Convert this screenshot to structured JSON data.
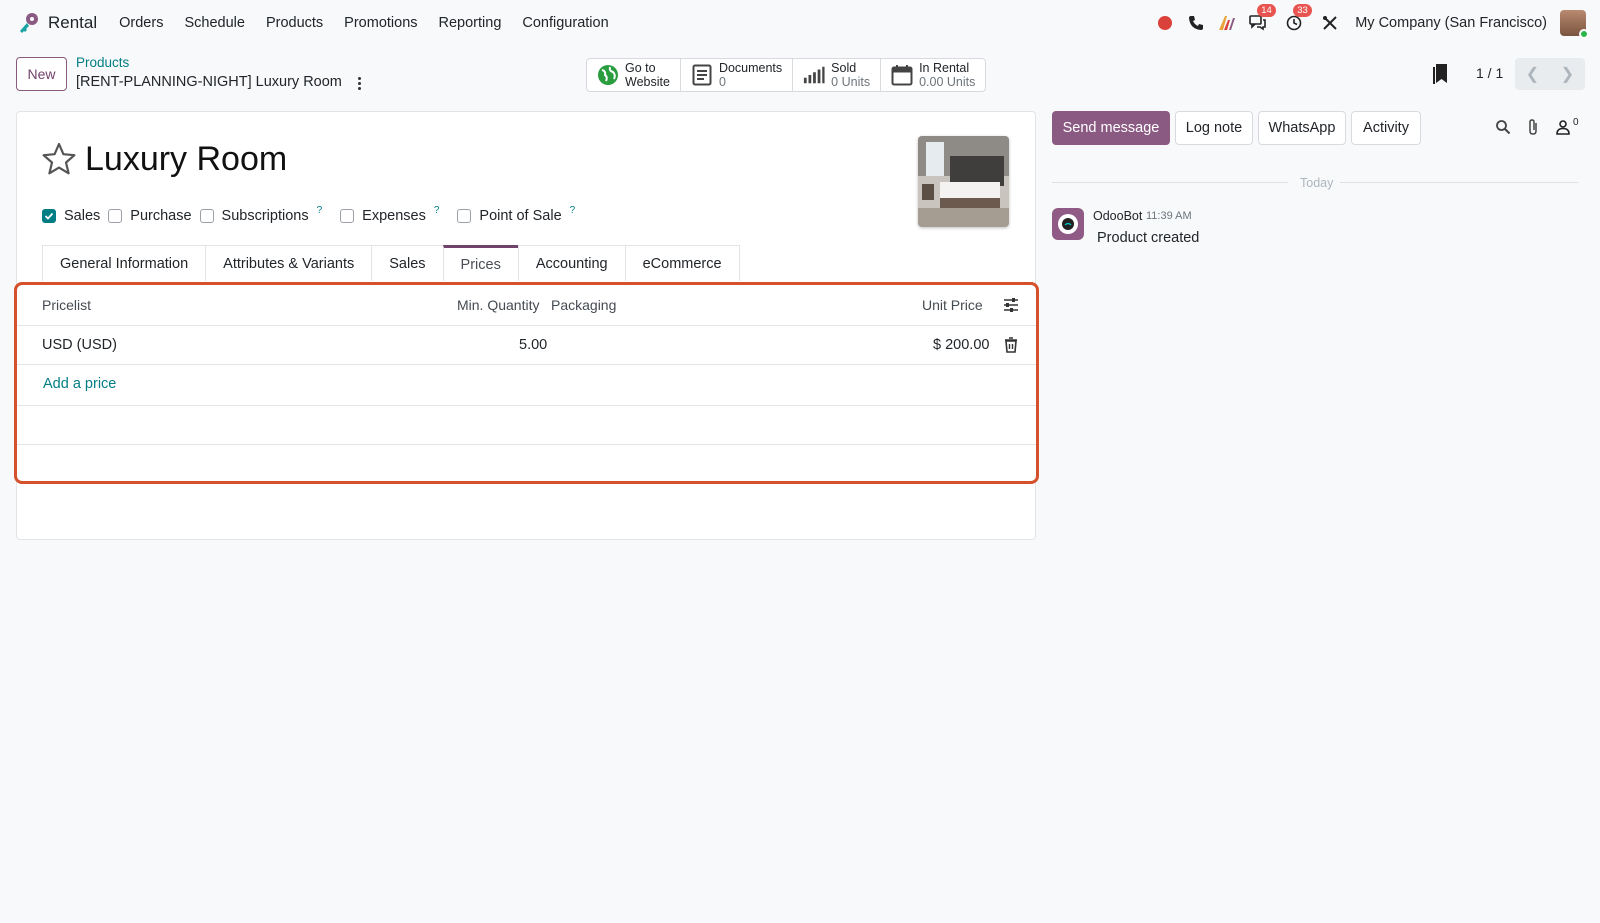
{
  "nav": {
    "app_name": "Rental",
    "menu": [
      "Orders",
      "Schedule",
      "Products",
      "Promotions",
      "Reporting",
      "Configuration"
    ],
    "messages_badge": "14",
    "activities_badge": "33",
    "company": "My Company (San Francisco)"
  },
  "control": {
    "new_label": "New",
    "breadcrumb_parent": "Products",
    "breadcrumb_current": "[RENT-PLANNING-NIGHT] Luxury Room",
    "stats": [
      {
        "title": "Go to",
        "value": "Website",
        "icon": "globe-icon"
      },
      {
        "title": "Documents",
        "value": "0",
        "icon": "document-icon"
      },
      {
        "title": "Sold",
        "value": "0 Units",
        "icon": "signal-bars-icon"
      },
      {
        "title": "In Rental",
        "value": "0.00 Units",
        "icon": "calendar-icon"
      }
    ],
    "pager": "1 / 1"
  },
  "form": {
    "title": "Luxury Room",
    "checkboxes": [
      {
        "label": "Sales",
        "checked": true,
        "help": ""
      },
      {
        "label": "Purchase",
        "checked": false,
        "help": ""
      },
      {
        "label": "Subscriptions",
        "checked": false,
        "help": "?"
      },
      {
        "label": "Expenses",
        "checked": false,
        "help": "?"
      },
      {
        "label": "Point of Sale",
        "checked": false,
        "help": "?"
      }
    ],
    "tabs": [
      "General Information",
      "Attributes & Variants",
      "Sales",
      "Prices",
      "Accounting",
      "eCommerce"
    ],
    "active_tab": "Prices"
  },
  "prices": {
    "headers": {
      "pricelist": "Pricelist",
      "min_qty": "Min. Quantity",
      "packaging": "Packaging",
      "unit_price": "Unit Price"
    },
    "rows": [
      {
        "pricelist": "USD (USD)",
        "min_qty": "5.00",
        "packaging": "",
        "unit_price": "$ 200.00"
      }
    ],
    "add_label": "Add a price"
  },
  "chatter": {
    "send_message": "Send message",
    "log_note": "Log note",
    "whatsapp": "WhatsApp",
    "activity": "Activity",
    "followers": "0",
    "today": "Today",
    "message": {
      "author": "OdooBot",
      "time": "11:39 AM",
      "body": "Product created"
    }
  },
  "colors": {
    "primary": "#71426a",
    "link": "#017e84",
    "highlight": "#d4512c"
  }
}
